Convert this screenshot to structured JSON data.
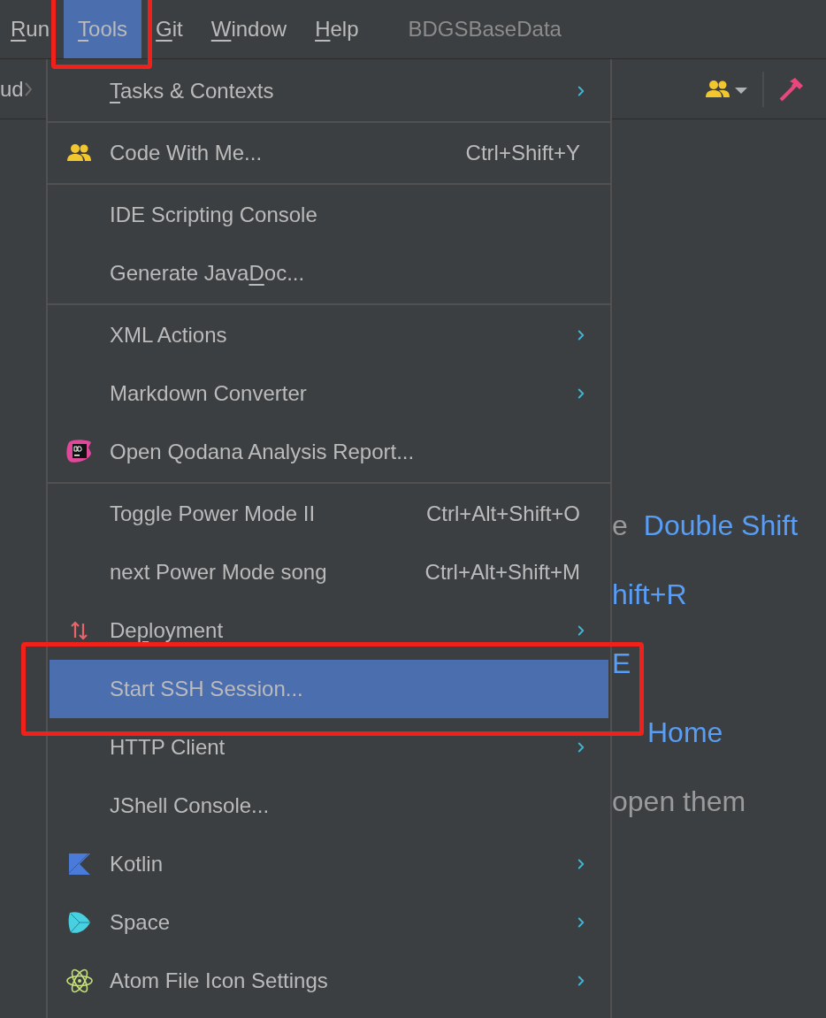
{
  "menu_bar": [
    {
      "key": "R",
      "after": "un",
      "selected": false,
      "annotated": false
    },
    {
      "key": "T",
      "after": "ools",
      "selected": true,
      "annotated": true
    },
    {
      "key": "G",
      "after": "it",
      "selected": false,
      "annotated": false
    },
    {
      "key": "W",
      "after": "indow",
      "selected": false,
      "annotated": false
    },
    {
      "key": "H",
      "after": "elp",
      "selected": false,
      "annotated": false
    }
  ],
  "project_title": "BDGSBaseData",
  "breadcrumb": "ud",
  "tools_menu": [
    {
      "kind": "plain",
      "key": "T",
      "after": "asks & Contexts",
      "submenu": true,
      "selected": false,
      "annotated": false
    },
    {
      "kind": "separator"
    },
    {
      "kind": "collaboration",
      "before": "Code With Me...",
      "shortcut": "Ctrl+Shift+Y",
      "submenu": false,
      "selected": false,
      "annotated": false
    },
    {
      "kind": "separator"
    },
    {
      "kind": "plain",
      "before": "IDE Scripting Console",
      "submenu": false,
      "selected": false,
      "annotated": false
    },
    {
      "kind": "plain",
      "before": "Generate Java",
      "key": "D",
      "after": "oc...",
      "submenu": false,
      "selected": false,
      "annotated": false
    },
    {
      "kind": "separator"
    },
    {
      "kind": "plain",
      "before": "XML Actions",
      "submenu": true,
      "selected": false,
      "annotated": false
    },
    {
      "kind": "plain",
      "before": "Markdown Converter",
      "submenu": true,
      "selected": false,
      "annotated": false
    },
    {
      "kind": "qodana",
      "before": "Open Qodana Analysis Report...",
      "submenu": false,
      "selected": false,
      "annotated": false
    },
    {
      "kind": "separator"
    },
    {
      "kind": "plain",
      "before": "Toggle Power Mode II",
      "shortcut": "Ctrl+Alt+Shift+O",
      "submenu": false,
      "selected": false,
      "annotated": false
    },
    {
      "kind": "plain",
      "before": "next Power Mode song",
      "shortcut": "Ctrl+Alt+Shift+M",
      "submenu": false,
      "selected": false,
      "annotated": false
    },
    {
      "kind": "deployment",
      "before": "De",
      "key": "p",
      "after": "loyment",
      "submenu": true,
      "selected": false,
      "annotated": false
    },
    {
      "kind": "plain",
      "before": "Start SSH Session...",
      "submenu": false,
      "selected": true,
      "annotated": true
    },
    {
      "kind": "plain",
      "before": "HTTP Client",
      "submenu": true,
      "selected": false,
      "annotated": false
    },
    {
      "kind": "plain",
      "before": "JShell Console...",
      "submenu": false,
      "selected": false,
      "annotated": false
    },
    {
      "kind": "kotlin",
      "before": "Kotlin",
      "submenu": true,
      "selected": false,
      "annotated": false
    },
    {
      "kind": "space",
      "before": "Space",
      "submenu": true,
      "selected": false,
      "annotated": false
    },
    {
      "kind": "atom",
      "before": "Atom File Icon Settings",
      "submenu": true,
      "selected": false,
      "annotated": false
    }
  ],
  "editor_hints": [
    {
      "text": "e",
      "shortcut": "Double Shift"
    },
    {
      "shortcut": "hift+R"
    },
    {
      "shortcut": "E"
    },
    {
      "shortcut": "Home"
    },
    {
      "text": "open them"
    }
  ]
}
